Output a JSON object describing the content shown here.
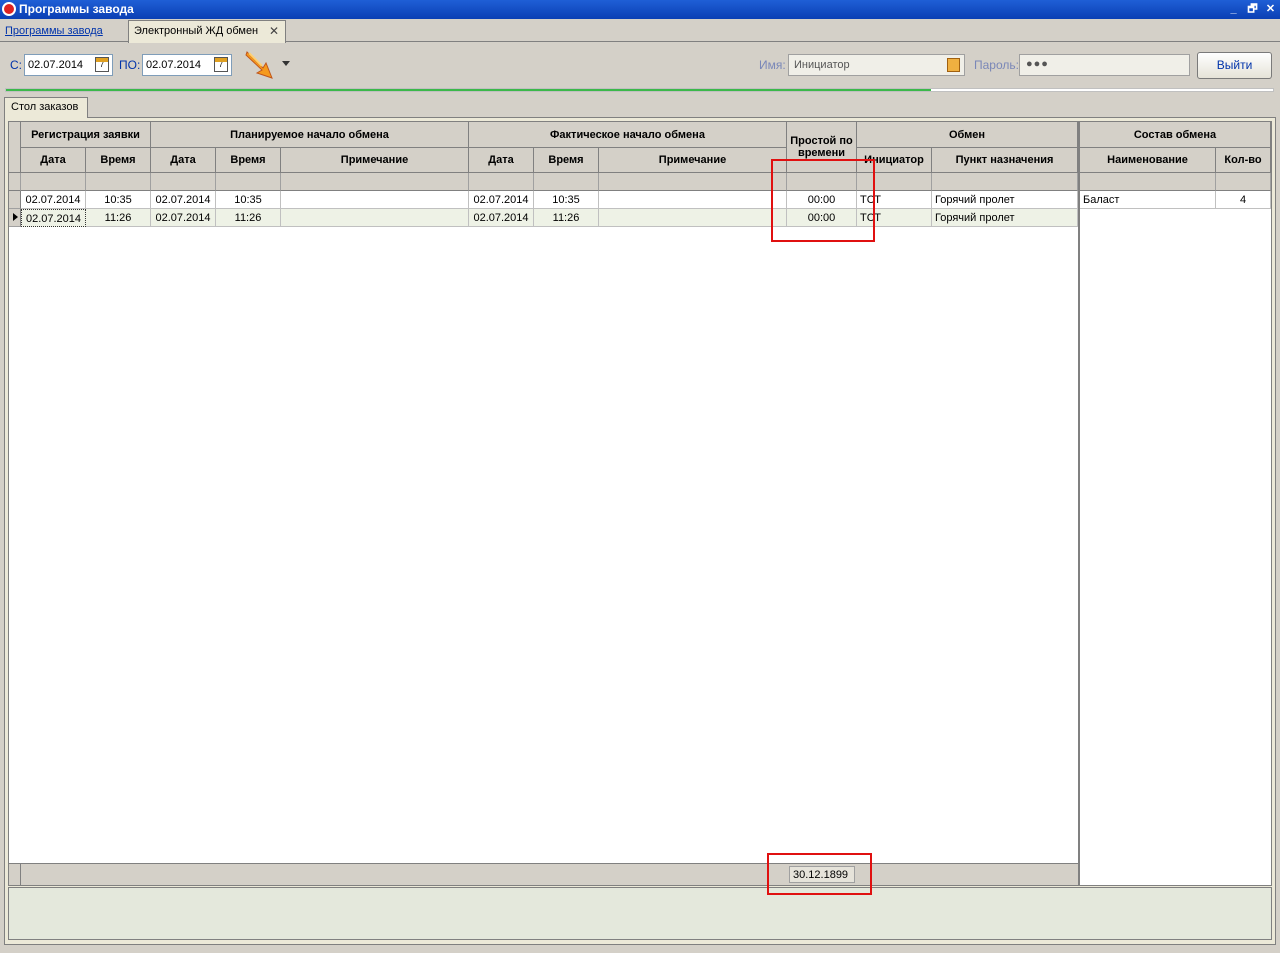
{
  "window": {
    "title": "Программы завода",
    "controls": [
      "_",
      "🗗",
      "✕"
    ]
  },
  "tabs": [
    {
      "label": "Программы завода",
      "active": false
    },
    {
      "label": "Электронный ЖД обмен",
      "active": true,
      "close": "✕"
    }
  ],
  "toolbar": {
    "from_label": "С:",
    "from_value": "02.07.2014",
    "to_label": "ПО:",
    "to_value": "02.07.2014",
    "calendar_glyph": "7",
    "name_label": "Имя:",
    "name_value": "Инициатор",
    "password_label": "Пароль:",
    "password_value": "●●●",
    "exit_label": "Выйти",
    "progress_fraction": 0.73
  },
  "subtab": {
    "label": "Стол заказов"
  },
  "grid": {
    "group_headers": {
      "registration": "Регистрация заявки",
      "planned": "Планируемое начало обмена",
      "actual": "Фактическое начало обмена",
      "downtime": "Простой по времени",
      "exchange": "Обмен"
    },
    "columns": {
      "reg_date": "Дата",
      "reg_time": "Время",
      "plan_date": "Дата",
      "plan_time": "Время",
      "plan_note": "Примечание",
      "act_date": "Дата",
      "act_time": "Время",
      "act_note": "Примечание",
      "initiator": "Инициатор",
      "destination": "Пункт назначения"
    },
    "rows": [
      {
        "reg_date": "02.07.2014",
        "reg_time": "10:35",
        "plan_date": "02.07.2014",
        "plan_time": "10:35",
        "plan_note": "",
        "act_date": "02.07.2014",
        "act_time": "10:35",
        "act_note": "",
        "downtime": "00:00",
        "initiator": "ТСТ",
        "destination": "Горячий пролет"
      },
      {
        "reg_date": "02.07.2014",
        "reg_time": "11:26",
        "plan_date": "02.07.2014",
        "plan_time": "11:26",
        "plan_note": "",
        "act_date": "02.07.2014",
        "act_time": "11:26",
        "act_note": "",
        "downtime": "00:00",
        "initiator": "ТСТ",
        "destination": "Горячий пролет"
      }
    ],
    "footer_sum": "30.12.1899"
  },
  "composition": {
    "group_header": "Состав обмена",
    "col_name": "Наименование",
    "col_qty": "Кол-во",
    "rows": [
      {
        "name": "Баласт",
        "qty": "4"
      }
    ]
  },
  "colors": {
    "titlebar": "#0a3fb4",
    "highlight": "#e01010",
    "progress": "#3cb84a"
  }
}
